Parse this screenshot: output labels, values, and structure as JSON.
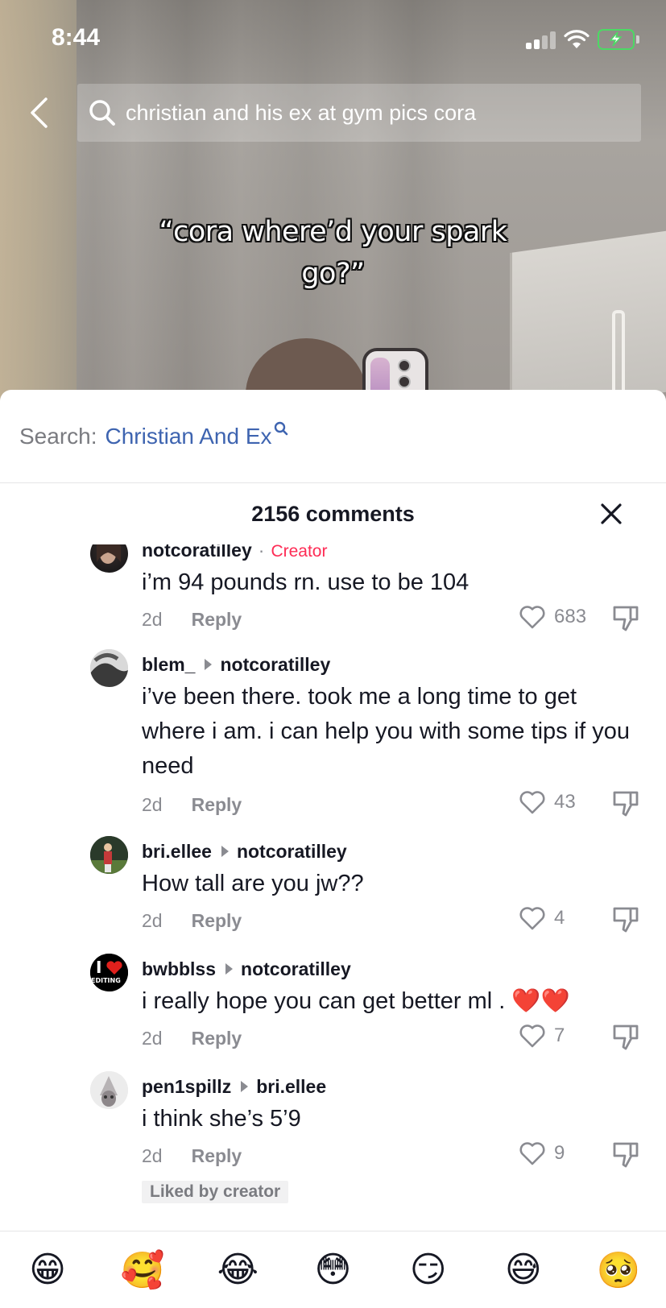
{
  "status_bar": {
    "time": "8:44"
  },
  "search": {
    "query": "christian and his ex at gym pics cora"
  },
  "video": {
    "caption_line1": "“cora where’d your spark",
    "caption_line2": "go?”"
  },
  "search_suggestion": {
    "prefix": "Search:",
    "term": "Christian And Ex"
  },
  "comments_header": {
    "count_label": "2156 comments"
  },
  "comments": [
    {
      "username": "notcoratilley",
      "creator_label": "Creator",
      "text": "i’m 94 pounds rn. use to be 104",
      "time": "2d",
      "reply": "Reply",
      "likes": "683"
    },
    {
      "username": "blem_",
      "reply_to": "notcoratilley",
      "text": "i’ve been there. took me a long time to get where i am. i can help you with some tips if you need",
      "time": "2d",
      "reply": "Reply",
      "likes": "43"
    },
    {
      "username": "bri.ellee",
      "reply_to": "notcoratilley",
      "text": "How tall are you jw??",
      "time": "2d",
      "reply": "Reply",
      "likes": "4"
    },
    {
      "username": "bwbblss",
      "reply_to": "notcoratilley",
      "text": "i really hope you can get better ml . ❤️❤️",
      "time": "2d",
      "reply": "Reply",
      "likes": "7",
      "avatar_text": "EDITING"
    },
    {
      "username": "pen1spillz",
      "reply_to": "bri.ellee",
      "text": "i think she’s 5’9",
      "time": "2d",
      "reply": "Reply",
      "likes": "9",
      "badge": "Liked by creator"
    }
  ],
  "emoji_bar": [
    "😁",
    "🥰",
    "😂",
    "😳",
    "😏",
    "😅",
    "🥺"
  ],
  "colors": {
    "accent_link": "#3e64b0",
    "creator_red": "#fe2c55",
    "battery_green": "#4cd964"
  }
}
